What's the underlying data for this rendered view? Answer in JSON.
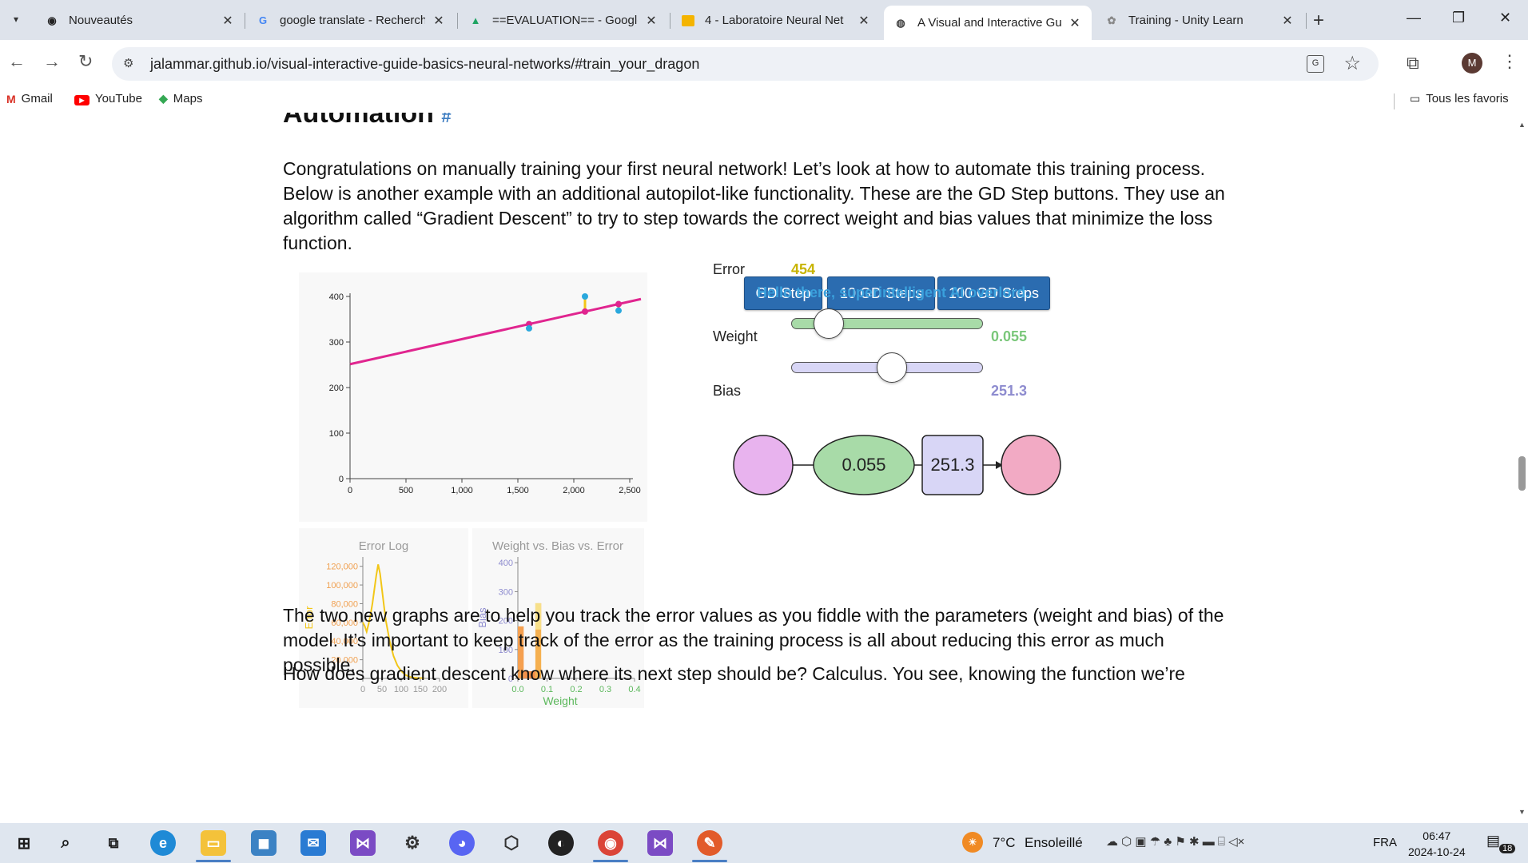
{
  "browser": {
    "tabs": [
      {
        "title": "Nouveautés",
        "favicon": "chrome-circle-icon"
      },
      {
        "title": "google translate - Recherche",
        "favicon": "google-g-icon"
      },
      {
        "title": "==EVALUATION== - Google",
        "favicon": "google-drive-icon"
      },
      {
        "title": "4 - Laboratoire Neural Net",
        "favicon": "slides-icon"
      },
      {
        "title": "A Visual and Interactive Gu",
        "favicon": "globe-icon",
        "active": true
      },
      {
        "title": "Training - Unity Learn",
        "favicon": "unity-icon"
      }
    ],
    "url": "jalammar.github.io/visual-interactive-guide-basics-neural-networks/#train_your_dragon",
    "avatar_letter": "M",
    "bookmarks": [
      {
        "label": "Gmail",
        "icon": "gmail-icon"
      },
      {
        "label": "YouTube",
        "icon": "youtube-icon"
      },
      {
        "label": "Maps",
        "icon": "maps-icon"
      }
    ],
    "all_bookmarks_label": "Tous les favoris"
  },
  "article": {
    "heading": "Automation",
    "heading_anchor": "#",
    "intro": "Congratulations on manually training your first neural network! Let’s look at how to automate this training process. Below is another example with an additional autopilot-like functionality. These are the GD Step buttons. They use an algorithm called “Gradient Descent” to try to step towards the correct weight and bias values that minimize the loss function.",
    "para2": "The two new graphs are to help you track the error values as you fiddle with the parameters (weight and bias) of the model. It’s important to keep track of the error as the training process is all about reducing this error as much possible.",
    "para3": "How does gradient descent know where its next step should be? Calculus. You see, knowing the function we’re"
  },
  "controls": {
    "gd_step": "GD Step",
    "gd_10": "10 GD Steps",
    "gd_100": "100 GD Steps",
    "error_label": "Error",
    "error_value": "454",
    "message": "Hello there, superintelligent AI overlord..",
    "weight_label": "Weight",
    "weight_value": "0.055",
    "bias_label": "Bias",
    "bias_value": "251.3",
    "weight_fraction": 0.14,
    "bias_fraction": 0.53,
    "weight_color": "#a8dba8",
    "bias_color": "#d8d6f6"
  },
  "network": {
    "weight_node": "0.055",
    "bias_node": "251.3",
    "input_color": "#e8b3ee",
    "weight_color": "#a8dba8",
    "bias_color": "#d8d6f6",
    "output_color": "#f2aac4"
  },
  "chart_data": [
    {
      "type": "scatter",
      "title": "",
      "xlim": [
        0,
        2500
      ],
      "ylim": [
        0,
        400
      ],
      "x_ticks": [
        "0",
        "500",
        "1,000",
        "1,500",
        "2,000",
        "2,500"
      ],
      "y_ticks": [
        "0",
        "100",
        "200",
        "300",
        "400"
      ],
      "points": [
        {
          "x": 1600,
          "y": 330
        },
        {
          "x": 2100,
          "y": 400
        },
        {
          "x": 2400,
          "y": 369
        }
      ],
      "line": {
        "weight": 0.055,
        "bias": 251.3,
        "x_range": [
          0,
          2600
        ],
        "color": "#e0258f"
      },
      "point_color": "#2aa8dd"
    },
    {
      "type": "line",
      "title": "Error Log",
      "ylabel": "Error",
      "xlim": [
        0,
        200
      ],
      "ylim": [
        0,
        130000
      ],
      "x_ticks": [
        "0",
        "50",
        "100",
        "150",
        "200"
      ],
      "y_ticks": [
        "20,000",
        "40,000",
        "60,000",
        "80,000",
        "100,000",
        "120,000"
      ],
      "x": [
        0,
        5,
        10,
        15,
        20,
        25,
        30,
        35,
        40,
        45,
        50,
        55,
        60,
        70,
        80,
        90,
        100,
        110,
        120,
        130,
        140,
        150,
        160
      ],
      "y": [
        60000,
        56000,
        50000,
        58000,
        68000,
        80000,
        95000,
        110000,
        122000,
        112000,
        95000,
        78000,
        62000,
        40000,
        24000,
        14000,
        8000,
        4000,
        2000,
        1000,
        500,
        454,
        454
      ],
      "line_color": "#f2c618"
    },
    {
      "type": "heatmap",
      "title": "Weight vs. Bias vs. Error",
      "xlabel": "Weight",
      "ylabel": "Bias",
      "xlim": [
        0,
        0.4
      ],
      "ylim": [
        0,
        420
      ],
      "x_ticks": [
        "0.0",
        "0.1",
        "0.2",
        "0.3",
        "0.4"
      ],
      "y_ticks": [
        "0",
        "100",
        "200",
        "300",
        "400"
      ],
      "cells": [
        {
          "w": 0.0,
          "b0": 0,
          "b1": 180,
          "color": "#f5a050"
        },
        {
          "w": 0.02,
          "b0": 0,
          "b1": 25,
          "color": "#f3904a"
        },
        {
          "w": 0.04,
          "b0": 0,
          "b1": 25,
          "color": "#f3904a"
        },
        {
          "w": 0.06,
          "b0": 0,
          "b1": 260,
          "color": "#f5b050"
        }
      ]
    }
  ],
  "taskbar": {
    "weather_temp": "7°C",
    "weather_text": "Ensoleillé",
    "language": "FRA",
    "time": "06:47",
    "date": "2024-10-24",
    "notifications": "18"
  }
}
